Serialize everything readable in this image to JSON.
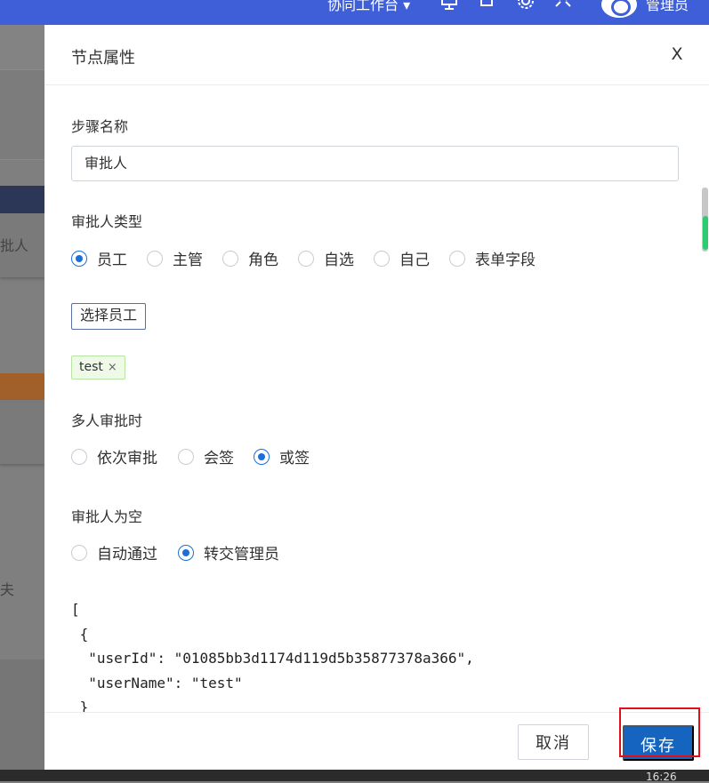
{
  "topbar": {
    "workspace_label": "协同工作台 ▾",
    "user_name": "管理员"
  },
  "background": {
    "fragment_1": "批人",
    "fragment_2": "夫"
  },
  "drawer": {
    "title": "节点属性",
    "close_label": "X",
    "step_name": {
      "label": "步骤名称",
      "value": "审批人"
    },
    "approver_type": {
      "label": "审批人类型",
      "options": [
        "员工",
        "主管",
        "角色",
        "自选",
        "自己",
        "表单字段"
      ],
      "selected": "员工"
    },
    "select_employee_label": "选择员工",
    "selected_tag": "test",
    "multi_approve": {
      "label": "多人审批时",
      "options": [
        "依次审批",
        "会签",
        "或签"
      ],
      "selected": "或签"
    },
    "empty_approver": {
      "label": "审批人为空",
      "options": [
        "自动通过",
        "转交管理员"
      ],
      "selected": "转交管理员"
    },
    "json_lines": [
      "[",
      " {",
      "  \"userId\": \"01085bb3d1174d119d5b35877378a366\",",
      "  \"userName\": \"test\"",
      " }"
    ],
    "footer": {
      "cancel_label": "取消",
      "save_label": "保存"
    }
  },
  "taskbar": {
    "clock": "16:26"
  },
  "colors": {
    "primary": "#1565c0",
    "radio_checked": "#1a6fdc",
    "highlight": "#e0101a",
    "topbar": "#3f5fd9"
  }
}
